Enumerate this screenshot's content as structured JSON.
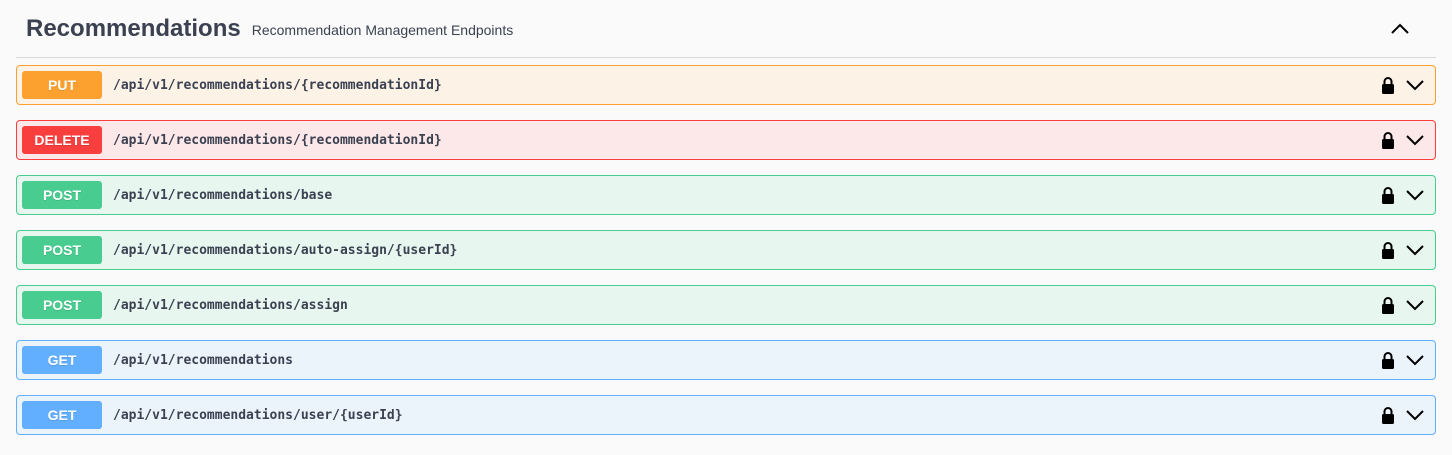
{
  "tag": {
    "title": "Recommendations",
    "description": "Recommendation Management Endpoints",
    "expanded": true
  },
  "operations": [
    {
      "method": "PUT",
      "path": "/api/v1/recommendations/{recommendationId}",
      "color": "#fca130",
      "locked": true
    },
    {
      "method": "DELETE",
      "path": "/api/v1/recommendations/{recommendationId}",
      "color": "#f93e3e",
      "locked": true
    },
    {
      "method": "POST",
      "path": "/api/v1/recommendations/base",
      "color": "#49cc90",
      "locked": true
    },
    {
      "method": "POST",
      "path": "/api/v1/recommendations/auto-assign/{userId}",
      "color": "#49cc90",
      "locked": true
    },
    {
      "method": "POST",
      "path": "/api/v1/recommendations/assign",
      "color": "#49cc90",
      "locked": true
    },
    {
      "method": "GET",
      "path": "/api/v1/recommendations",
      "color": "#61affe",
      "locked": true
    },
    {
      "method": "GET",
      "path": "/api/v1/recommendations/user/{userId}",
      "color": "#61affe",
      "locked": true
    }
  ],
  "icons": {
    "collapse": "chevron-up-icon",
    "lock": "lock-icon",
    "expand": "chevron-down-icon"
  }
}
